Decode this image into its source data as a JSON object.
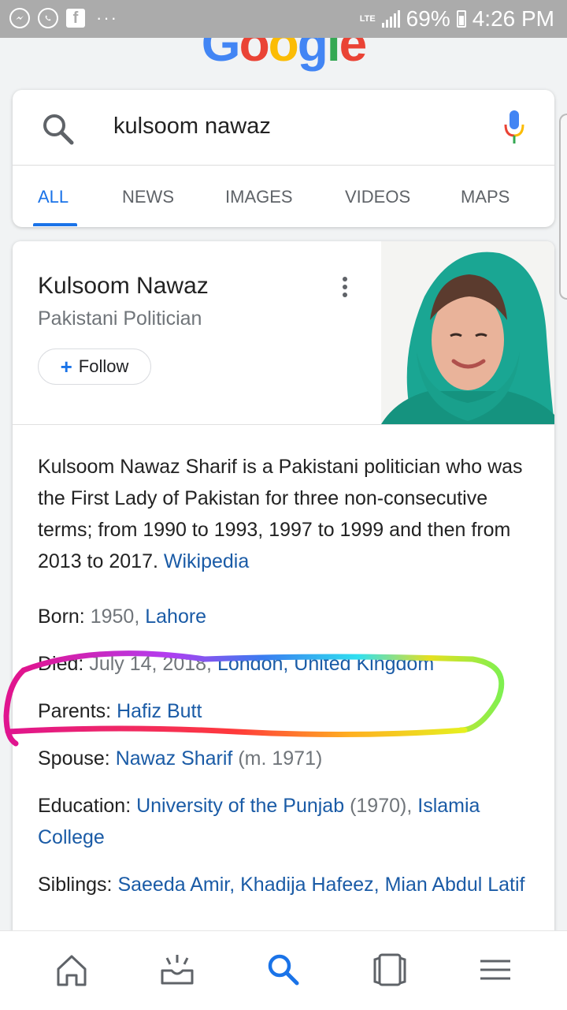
{
  "status_bar": {
    "network": "LTE",
    "battery": "69%",
    "time": "4:26 PM",
    "dots": "···"
  },
  "search": {
    "logo": "Google",
    "query": "kulsoom nawaz",
    "tabs": [
      "ALL",
      "NEWS",
      "IMAGES",
      "VIDEOS",
      "MAPS"
    ],
    "active_tab": "ALL"
  },
  "knowledge_panel": {
    "title": "Kulsoom Nawaz",
    "subtitle": "Pakistani Politician",
    "follow_label": "Follow",
    "description": "Kulsoom Nawaz Sharif is a Pakistani politician who was the First Lady of Pakistan for three non-consecutive terms; from 1990 to 1993, 1997 to 1999 and then from 2013 to 2017.",
    "source": "Wikipedia",
    "facts": {
      "born": {
        "label": "Born:",
        "year": "1950,",
        "place": "Lahore"
      },
      "died": {
        "label": "Died:",
        "date": "July 14, 2018,",
        "place1": "London,",
        "place2": "United Kingdom"
      },
      "parents": {
        "label": "Parents:",
        "value": "Hafiz Butt"
      },
      "spouse": {
        "label": "Spouse:",
        "value": "Nawaz Sharif",
        "note": "(m. 1971)"
      },
      "education": {
        "label": "Education:",
        "school1": "University of the Punjab",
        "year1": "(1970),",
        "school2": "Islamia College"
      },
      "siblings": {
        "label": "Siblings:",
        "value1": "Saeeda Amir,",
        "value2": "Khadija Hafeez,",
        "value3": "Mian Abdul Latif"
      }
    }
  },
  "colors": {
    "link": "#1a5ba6",
    "accent": "#1a73e8",
    "status_bar": "#ababab"
  }
}
